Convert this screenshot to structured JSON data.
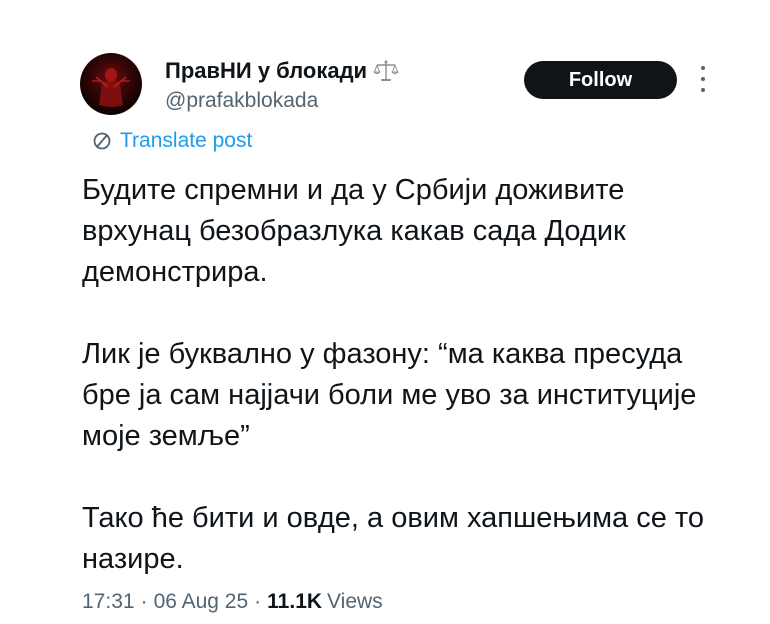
{
  "author": {
    "display_name": "ПравНИ у блокади",
    "handle": "@prafakblokada",
    "badge_icon": "scales-icon"
  },
  "follow_button": {
    "label": "Follow"
  },
  "more_menu": {
    "icon": "more-vertical-icon"
  },
  "translate": {
    "icon": "translate-icon",
    "label": "Translate post"
  },
  "tweet": {
    "paragraphs": [
      "Будите спремни и да у Србији доживите врхунац безобразлука какав сада Додик демонстрира.",
      "Лик је буквално у фазону: “ма каква пресуда бре ја сам најјачи боли ме уво за институције моје земље”",
      "Тако ће бити и овде, а овим хапшењима се то назире."
    ]
  },
  "meta": {
    "time": "17:31",
    "separator": "·",
    "date": "06 Aug 25",
    "views_count": "11.1K",
    "views_label": "Views"
  },
  "colors": {
    "text_primary": "#0f1419",
    "text_secondary": "#536471",
    "link": "#1d9bf0",
    "button_bg": "#0f1419"
  }
}
